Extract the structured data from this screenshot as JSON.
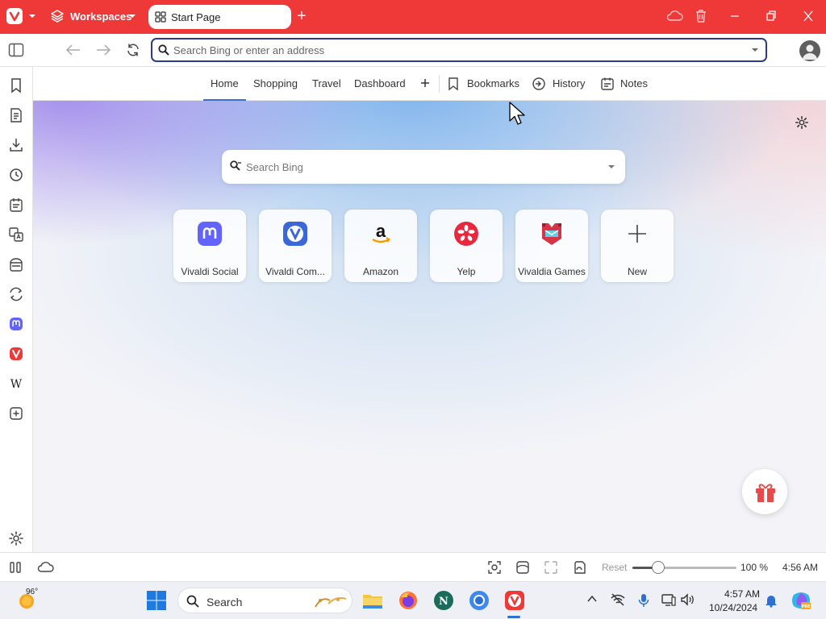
{
  "titlebar": {
    "workspaces_label": "Workspaces",
    "tab_title": "Start Page"
  },
  "addressbar": {
    "placeholder": "Search Bing or enter an address",
    "value": ""
  },
  "navbar": {
    "links": [
      "Home",
      "Shopping",
      "Travel",
      "Dashboard"
    ],
    "active": "Home",
    "bookmarks": "Bookmarks",
    "history": "History",
    "notes": "Notes"
  },
  "search": {
    "placeholder": "Search Bing"
  },
  "speed_dials": [
    {
      "label": "Vivaldi Social",
      "icon": "mastodon-icon"
    },
    {
      "label": "Vivaldi Com...",
      "icon": "vivaldi-icon"
    },
    {
      "label": "Amazon",
      "icon": "amazon-icon"
    },
    {
      "label": "Yelp",
      "icon": "yelp-icon"
    },
    {
      "label": "Vivaldia Games",
      "icon": "vivaldia-games-icon"
    },
    {
      "label": "New",
      "icon": "plus-icon"
    }
  ],
  "statusbar": {
    "reset": "Reset",
    "zoom_label": "100 %",
    "zoom_level": 0.25,
    "clock": "4:56 AM"
  },
  "taskbar": {
    "weather_temp": "96°",
    "search_label": "Search",
    "time": "4:57 AM",
    "date": "10/24/2024"
  },
  "colors": {
    "vivaldi_red": "#ef3939",
    "accent_blue": "#3b6fd4",
    "address_border": "#2c3b8a"
  }
}
